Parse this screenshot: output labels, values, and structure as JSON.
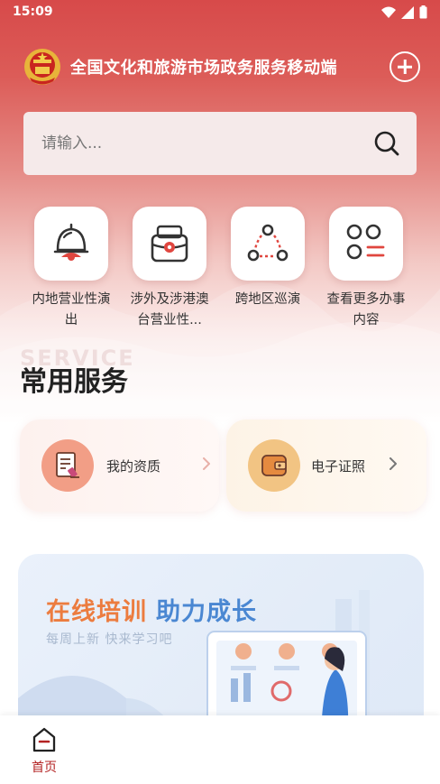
{
  "status_bar": {
    "time": "15:09"
  },
  "header": {
    "title": "全国文化和旅游市场政务服务移动端"
  },
  "search": {
    "placeholder": "请输入..."
  },
  "quick_menu": {
    "items": [
      {
        "label": "内地营业性演出",
        "icon": "bell-icon"
      },
      {
        "label": "涉外及涉港澳台营业性...",
        "icon": "briefcase-icon"
      },
      {
        "label": "跨地区巡演",
        "icon": "network-icon"
      },
      {
        "label": "查看更多办事内容",
        "icon": "grid-menu-icon"
      }
    ]
  },
  "watermark": "SERVICE",
  "section": {
    "title": "常用服务"
  },
  "services": [
    {
      "label": "我的资质",
      "icon": "certificate-icon",
      "color": "#f29e86"
    },
    {
      "label": "电子证照",
      "icon": "wallet-icon",
      "color": "#f2c483"
    }
  ],
  "banner": {
    "title_part1": "在线培训",
    "title_part2": "助力成长",
    "subtitle": "每周上新  快来学习吧",
    "colors": {
      "part1": "#ec7c3f",
      "part2": "#4a87d2"
    }
  },
  "bottom_nav": {
    "home_label": "首页",
    "active_color": "#b32222"
  },
  "theme": {
    "primary": "#d74a4a",
    "accent": "#e0463f"
  }
}
